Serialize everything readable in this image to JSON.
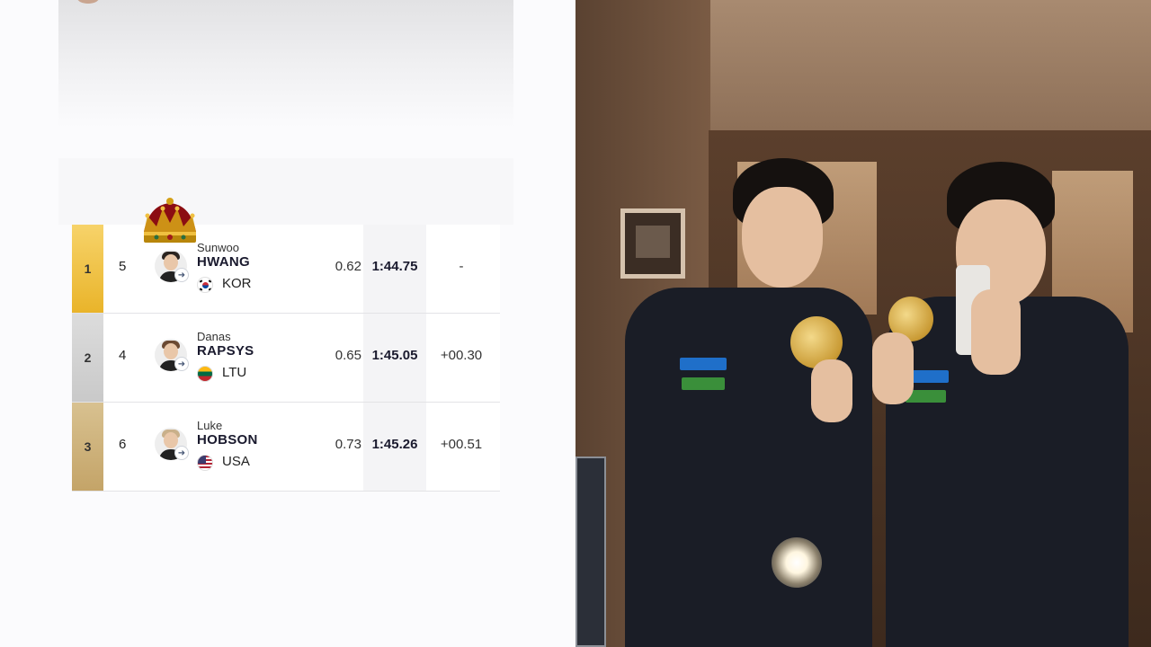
{
  "results": [
    {
      "rank": "1",
      "lane": "5",
      "first_name": "Sunwoo",
      "last_name": "HWANG",
      "country": "KOR",
      "flag": "flag-kor",
      "reaction": "0.62",
      "time": "1:44.75",
      "diff": "-",
      "medal": "gold"
    },
    {
      "rank": "2",
      "lane": "4",
      "first_name": "Danas",
      "last_name": "RAPSYS",
      "country": "LTU",
      "flag": "flag-ltu",
      "reaction": "0.65",
      "time": "1:45.05",
      "diff": "+00.30",
      "medal": "silver"
    },
    {
      "rank": "3",
      "lane": "6",
      "first_name": "Luke",
      "last_name": "HOBSON",
      "country": "USA",
      "flag": "flag-usa",
      "reaction": "0.73",
      "time": "1:45.26",
      "diff": "+00.51",
      "medal": "bronze"
    }
  ],
  "icons": {
    "crown": "crown-icon",
    "profile_arrow": "arrow-right-icon"
  },
  "colors": {
    "gold": "#e9b42a",
    "silver": "#c9c9c9",
    "bronze": "#c4a468"
  },
  "photo": {
    "description_icon": "photo-image"
  }
}
